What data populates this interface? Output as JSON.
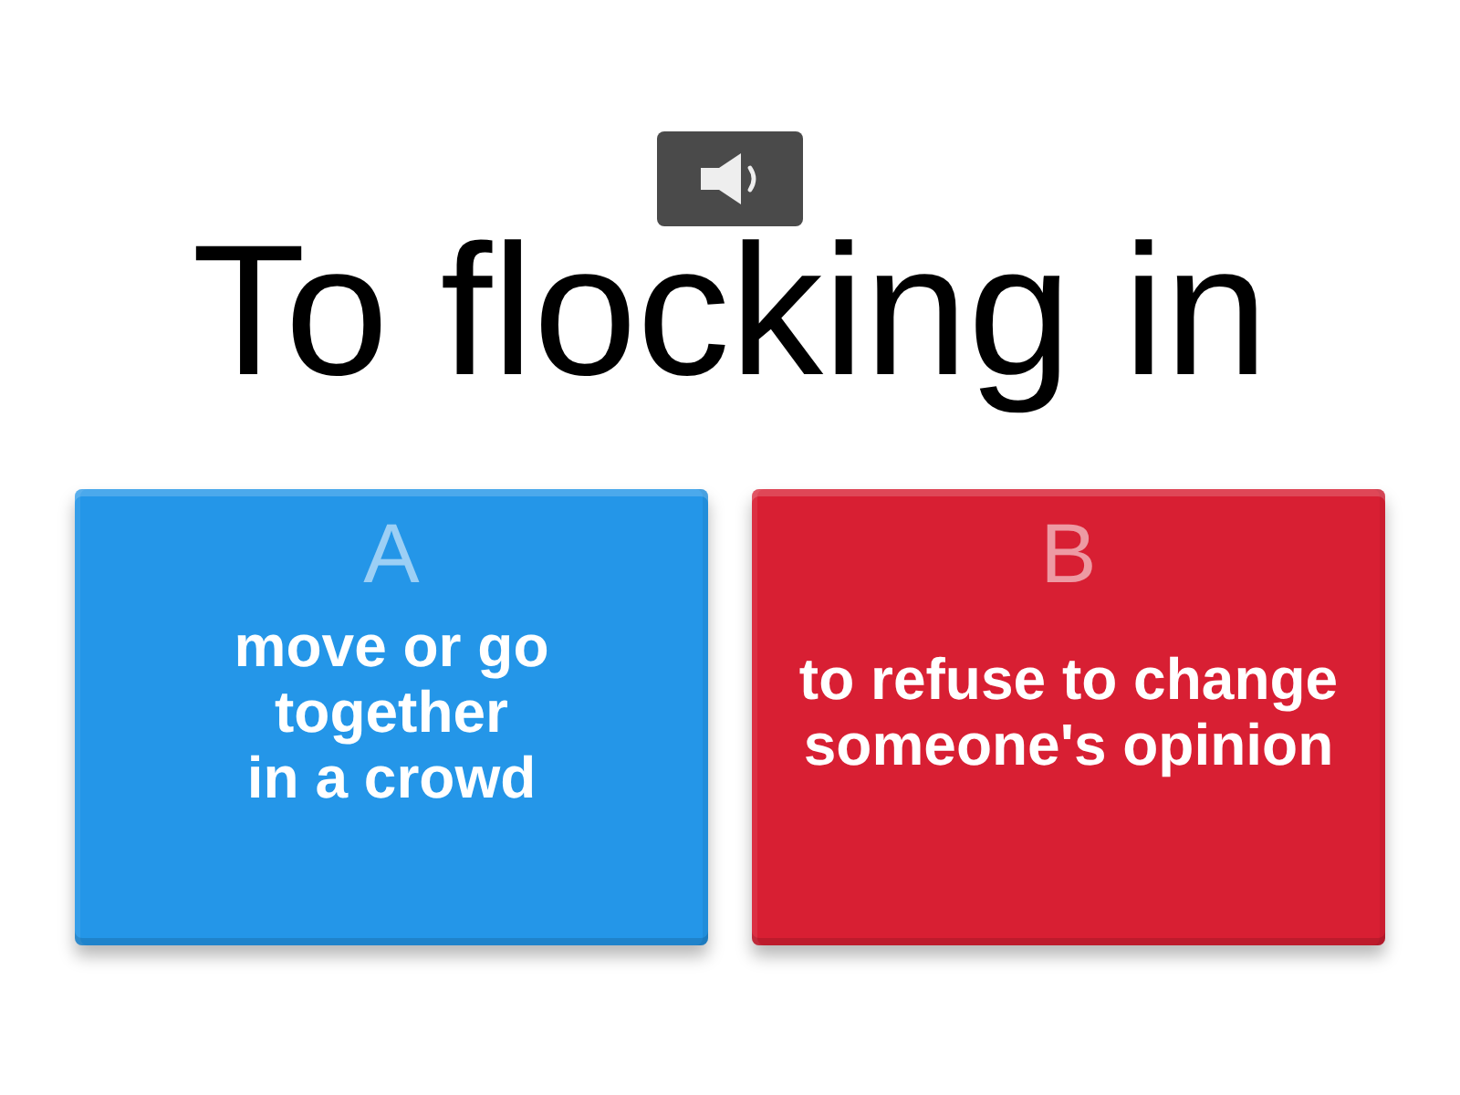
{
  "question": {
    "text": "To flocking in"
  },
  "answers": [
    {
      "letter": "A",
      "text": "move or go\ntogether\nin a crowd",
      "color": "#2496e8"
    },
    {
      "letter": "B",
      "text": "to refuse to change someone's opinion",
      "color": "#d81f33"
    }
  ]
}
